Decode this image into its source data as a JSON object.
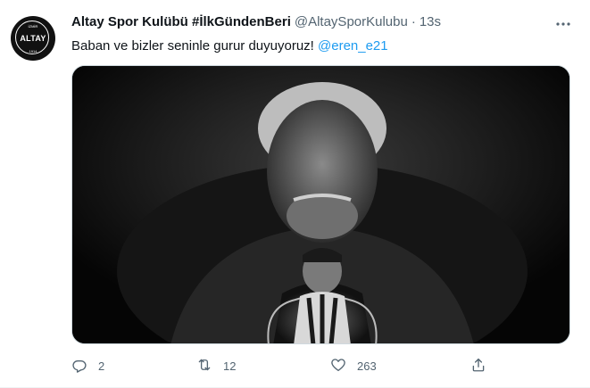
{
  "tweet": {
    "display_name": "Altay Spor Kulübü #İlkGündenBeri",
    "handle": "@AltaySporKulubu",
    "separator": "·",
    "time": "13s",
    "text_main": "Baban ve bizler seninle gurur duyuyoruz! ",
    "mention": "@eren_e21",
    "avatar": {
      "mark": "ALTAY",
      "top_text": "İZMİR",
      "bottom_text": "1914"
    },
    "media": {
      "icon": "photo-image",
      "description_colors": {
        "background": "#000000",
        "figure": "#9a9a9a"
      }
    },
    "actions": {
      "reply_count": "2",
      "retweet_count": "12",
      "like_count": "263"
    },
    "colors": {
      "accent": "#1d9bf0",
      "secondary_text": "#536471",
      "primary_text": "#0f1419"
    }
  }
}
